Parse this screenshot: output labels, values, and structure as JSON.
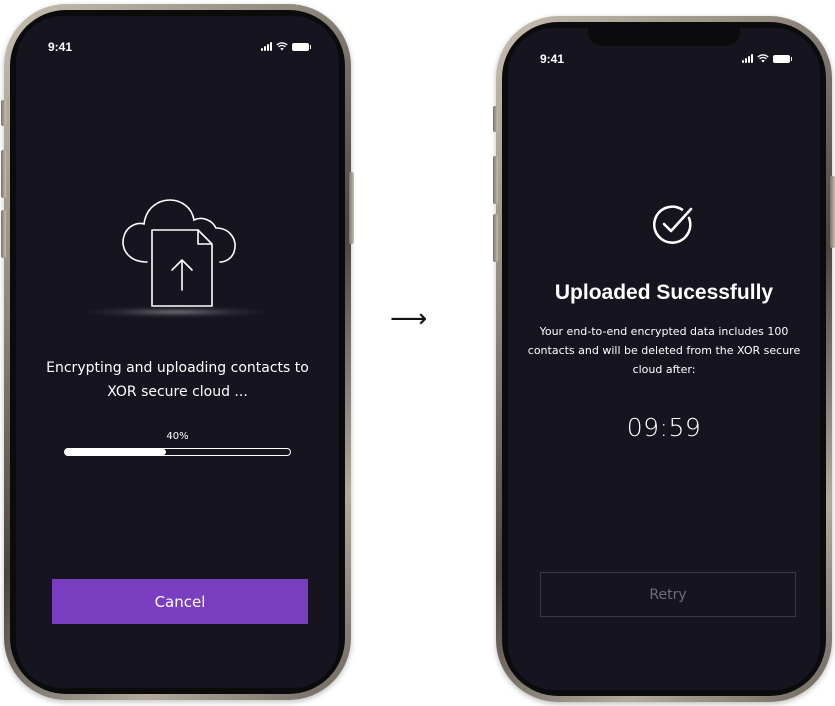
{
  "flow_arrow": "⟶",
  "left_screen": {
    "status": {
      "time": "9:41"
    },
    "illustration_icon": "cloud-upload-document-icon",
    "message": "Encrypting and uploading contacts to XOR secure cloud ...",
    "progress": {
      "label": "40%",
      "fraction": 0.45
    },
    "cancel_label": "Cancel",
    "colors": {
      "background": "#15141f",
      "accent": "#7a3fc0"
    }
  },
  "right_screen": {
    "status": {
      "time": "9:41"
    },
    "status_icon": "check-circle-icon",
    "title": "Uploaded Sucessfully",
    "description": "Your end-to-end encrypted data includes 100 contacts and will be deleted from the XOR secure cloud after:",
    "countdown": "09:59",
    "retry_label": "Retry",
    "colors": {
      "background": "#15141f",
      "retry_text": "#6f6d7c"
    }
  }
}
